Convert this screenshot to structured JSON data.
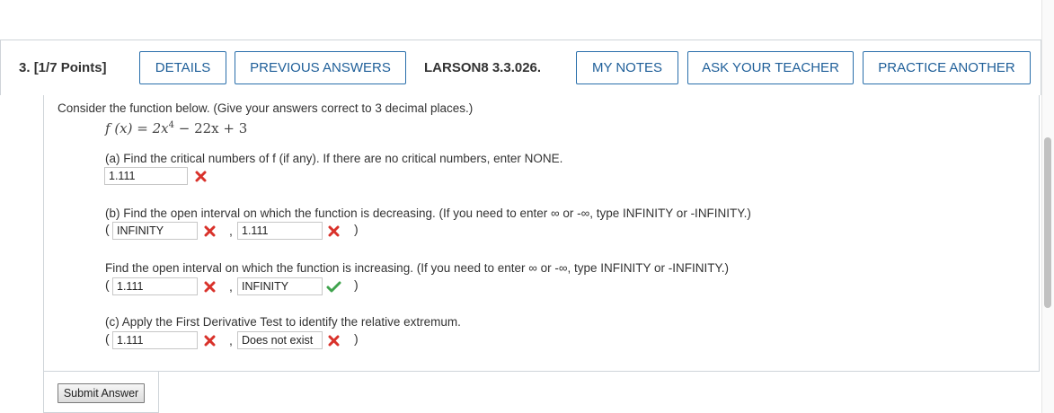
{
  "header": {
    "question_number": "3.",
    "points": "[1/7 Points]",
    "buttons": {
      "details": "DETAILS",
      "previous_answers": "PREVIOUS ANSWERS",
      "my_notes": "MY NOTES",
      "ask_your_teacher": "ASK YOUR TEACHER",
      "practice_another": "PRACTICE ANOTHER"
    },
    "reference": "LARSON8 3.3.026.",
    "accent_color": "#2a6fab"
  },
  "question": {
    "intro": "Consider the function below. (Give your answers correct to 3 decimal places.)",
    "formula": {
      "lhs": "f (x) = 2x",
      "exponent": "4",
      "rhs": " − 22x + 3"
    },
    "part_a": {
      "prompt": "(a) Find the critical numbers of f (if any). If there are no critical numbers, enter NONE.",
      "answer": "1.111",
      "status": "incorrect"
    },
    "part_b": {
      "prompt": "(b) Find the open interval on which the function is decreasing. (If you need to enter ∞ or -∞, type INFINITY or -INFINITY.)",
      "open_paren": "(",
      "answer_left": "INFINITY",
      "status_left": "incorrect",
      "comma": ",",
      "answer_right": "1.111",
      "status_right": "incorrect",
      "close_paren": ")"
    },
    "part_b2": {
      "prompt": "Find the open interval on which the function is increasing. (If you need to enter ∞ or -∞, type INFINITY or -INFINITY.)",
      "open_paren": "(",
      "answer_left": "1.111",
      "status_left": "incorrect",
      "comma": ",",
      "answer_right": "INFINITY",
      "status_right": "correct",
      "close_paren": ")"
    },
    "part_c": {
      "prompt": "(c) Apply the First Derivative Test to identify the relative extremum.",
      "open_paren": "(",
      "answer_left": "1.111",
      "status_left": "incorrect",
      "comma": ",",
      "answer_right": "Does not exist",
      "status_right": "incorrect",
      "close_paren": ")"
    }
  },
  "footer": {
    "submit_label": "Submit Answer"
  },
  "icons": {
    "incorrect": "x-mark-icon",
    "correct": "check-mark-icon",
    "incorrect_color": "#d9322b",
    "correct_color": "#3fa34d"
  }
}
